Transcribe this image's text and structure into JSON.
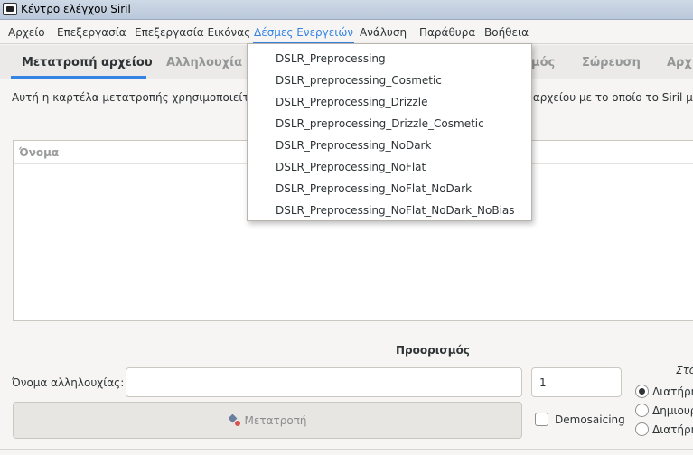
{
  "window": {
    "title": "Κέντρο ελέγχου Siril"
  },
  "menubar": {
    "items": [
      "Αρχείο",
      "Επεξεργασία",
      "Επεξεργασία Εικόνας",
      "Δέσμες Ενεργειών",
      "Ανάλυση",
      "Παράθυρα",
      "Βοήθεια"
    ],
    "active": "Δέσμες Ενεργειών"
  },
  "tabs": {
    "items": [
      "Μετατροπή αρχείου",
      "Αλληλουχία",
      "μός",
      "Σώρευση",
      "Αρχ"
    ],
    "active": "Μετατροπή αρχείου"
  },
  "main": {
    "description_left": "Αυτή η καρτέλα μετατροπής χρησιμοποιείται γ",
    "description_right": "ι αρχείου με το οποίο το Siril μπ",
    "file_list_header": "Όνομα"
  },
  "destination": {
    "title": "Προορισμός",
    "sequence_label": "Όνομα αλληλουχίας:",
    "sequence_value": "",
    "start_number": "1",
    "convert_button": "Μετατροπή",
    "demosaicing_label": "Demosaicing",
    "demosaicing_checked": false,
    "right_heading": "Στό",
    "options": [
      {
        "label": "Διατήρη",
        "checked": true
      },
      {
        "label": "Δημιουρ",
        "checked": false
      },
      {
        "label": "Διατήρη",
        "checked": false
      }
    ]
  },
  "scripts_menu": {
    "items": [
      "DSLR_Preprocessing",
      "DSLR_preprocessing_Cosmetic",
      "DSLR_Preprocessing_Drizzle",
      "DSLR_preprocessing_Drizzle_Cosmetic",
      "DSLR_Preprocessing_NoDark",
      "DSLR_Preprocessing_NoFlat",
      "DSLR_Preprocessing_NoFlat_NoDark",
      "DSLR_Preprocessing_NoFlat_NoDark_NoBias"
    ]
  },
  "colors": {
    "accent": "#3584e4",
    "text": "#2e3436",
    "muted_tab": "#949797"
  }
}
